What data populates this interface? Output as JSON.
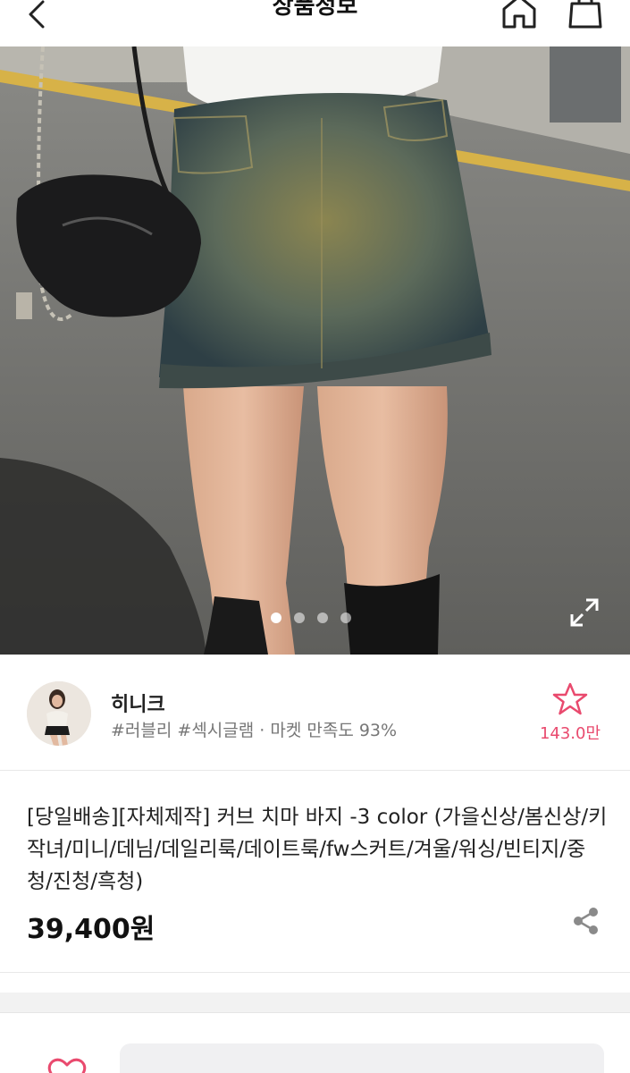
{
  "header": {
    "title": "상품정보",
    "back_icon": "chevron-left-icon",
    "home_icon": "home-icon",
    "bag_icon": "shopping-bag-icon"
  },
  "gallery": {
    "image_description_icon": "product-photo",
    "dots": [
      true,
      false,
      false,
      false
    ],
    "expand_icon": "expand-icon"
  },
  "seller": {
    "name": "히니크",
    "tags": "#러블리 #섹시글램 · 마켓 만족도 93%",
    "favorite_count": "143.0만",
    "favorite_icon": "star-outline-icon"
  },
  "product": {
    "title": "[당일배송][자체제작] 커브 치마 바지 -3 color (가을신상/봄신상/키작녀/미니/데님/데일리룩/데이트룩/fw스커트/겨울/워싱/빈티지/중청/진청/흑청)",
    "price": "39,400원",
    "share_icon": "share-icon"
  },
  "colors": {
    "accent": "#e94a6e",
    "text": "#111111",
    "muted": "#777777"
  }
}
